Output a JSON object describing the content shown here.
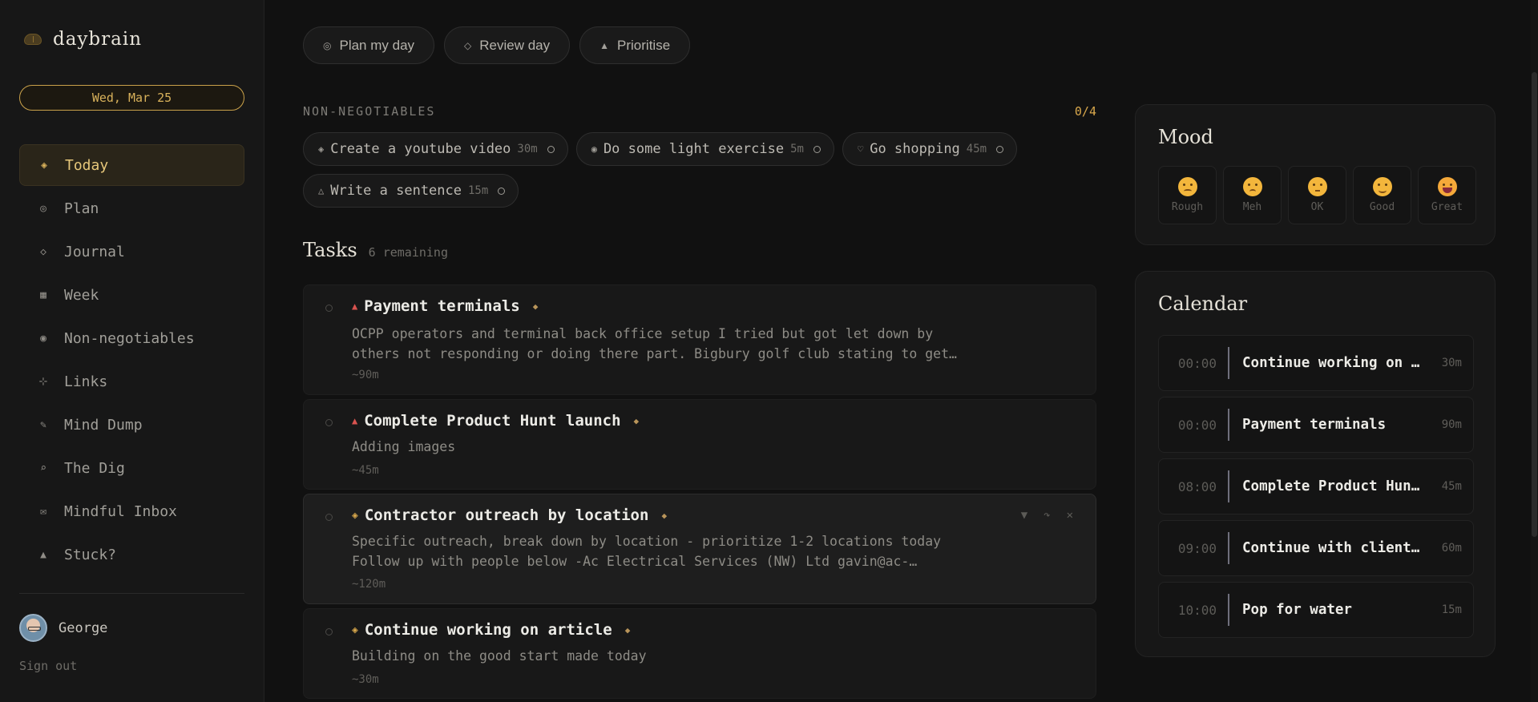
{
  "app": {
    "name": "daybrain",
    "date": "Wed, Mar 25"
  },
  "sidebar": {
    "items": [
      {
        "label": "Today",
        "icon": "◈"
      },
      {
        "label": "Plan",
        "icon": "◎"
      },
      {
        "label": "Journal",
        "icon": "◇"
      },
      {
        "label": "Week",
        "icon": "▦"
      },
      {
        "label": "Non-negotiables",
        "icon": "◉"
      },
      {
        "label": "Links",
        "icon": "⊹"
      },
      {
        "label": "Mind Dump",
        "icon": "✎"
      },
      {
        "label": "The Dig",
        "icon": "⌕"
      },
      {
        "label": "Mindful Inbox",
        "icon": "✉"
      },
      {
        "label": "Stuck?",
        "icon": "▲"
      }
    ],
    "user": {
      "name": "George",
      "signout": "Sign out"
    }
  },
  "actions": [
    {
      "label": "Plan my day",
      "icon": "◎"
    },
    {
      "label": "Review day",
      "icon": "◇"
    },
    {
      "label": "Prioritise",
      "icon": "▲"
    }
  ],
  "non_negotiables": {
    "title": "NON-NEGOTIABLES",
    "count": "0/4",
    "items": [
      {
        "icon": "◈",
        "label": "Create a youtube video",
        "duration": "30m"
      },
      {
        "icon": "◉",
        "label": "Do some light exercise",
        "duration": "5m"
      },
      {
        "icon": "♡",
        "label": "Go shopping",
        "duration": "45m"
      },
      {
        "icon": "△",
        "label": "Write a sentence",
        "duration": "15m"
      }
    ]
  },
  "tasks": {
    "title": "Tasks",
    "remaining": "6 remaining",
    "items": [
      {
        "priority": "▲",
        "title": "Payment terminals",
        "desc": "OCPP operators and terminal back office setup I tried but got let down by\nothers not responding or doing there part. Bigbury golf club stating to get…",
        "duration": "~90m"
      },
      {
        "priority": "▲",
        "title": "Complete Product Hunt launch",
        "desc": "Adding images",
        "duration": "~45m"
      },
      {
        "priority": "◈",
        "title": "Contractor outreach by location",
        "desc": "Specific outreach, break down by location - prioritize 1-2 locations today\nFollow up with people below -Ac Electrical Services (NW) Ltd gavin@ac-…",
        "duration": "~120m",
        "tools": [
          "▼",
          "↷",
          "✕"
        ]
      },
      {
        "priority": "◈",
        "title": "Continue working on article",
        "desc": "Building on the good start made today",
        "duration": "~30m"
      }
    ]
  },
  "mood": {
    "title": "Mood",
    "options": [
      "Rough",
      "Meh",
      "OK",
      "Good",
      "Great"
    ]
  },
  "calendar": {
    "title": "Calendar",
    "events": [
      {
        "time": "00:00",
        "title": "Continue working on article",
        "duration": "30m"
      },
      {
        "time": "00:00",
        "title": "Payment terminals",
        "duration": "90m"
      },
      {
        "time": "08:00",
        "title": "Complete Product Hunt launch",
        "duration": "45m"
      },
      {
        "time": "09:00",
        "title": "Continue with client calls",
        "duration": "60m"
      },
      {
        "time": "10:00",
        "title": "Pop for water",
        "duration": "15m"
      }
    ]
  },
  "colors": {
    "accent": "#d9b25b",
    "priority_high": "#d9534f",
    "background": "#111111"
  }
}
